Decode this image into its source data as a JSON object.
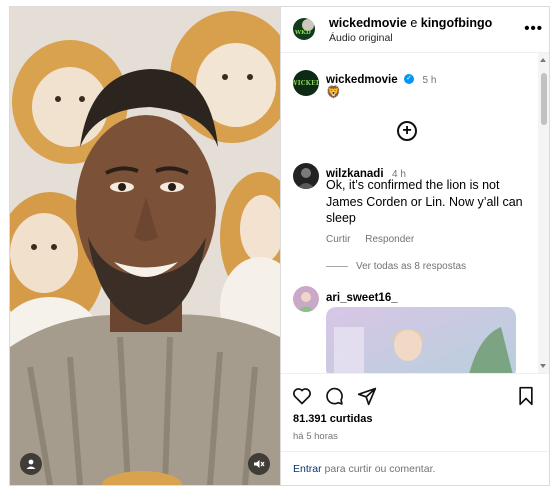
{
  "header": {
    "user_primary": "wickedmovie",
    "connector": "e",
    "user_secondary": "kingofbingo",
    "subtitle": "Áudio original",
    "more_label": "•••"
  },
  "caption": {
    "username": "wickedmovie",
    "verified_mark": "✓",
    "time": "5 h",
    "text": "🦁",
    "add_label": "+"
  },
  "comments": [
    {
      "username": "wilzkanadi",
      "time": "4 h",
      "text": "Ok, it’s confirmed the lion is not James Corden or Lin. Now y’all can sleep",
      "reply_label": "Curtir",
      "answer_label": "Responder",
      "view_replies": "Ver todas as 8 respostas"
    },
    {
      "username": "ari_sweet16_"
    }
  ],
  "footer": {
    "likes": "81.391 curtidas",
    "time_ago": "há 5 horas",
    "login_link": "Entrar",
    "login_text": "para curtir ou comentar."
  },
  "icons": {
    "like": "heart-icon",
    "comment": "comment-icon",
    "share": "share-icon",
    "save": "bookmark-icon",
    "user_tag": "user-tag-icon",
    "mute": "muted-speaker-icon"
  },
  "colors": {
    "link": "#00376b",
    "verified": "#0095f6",
    "muted_text": "#737373"
  }
}
